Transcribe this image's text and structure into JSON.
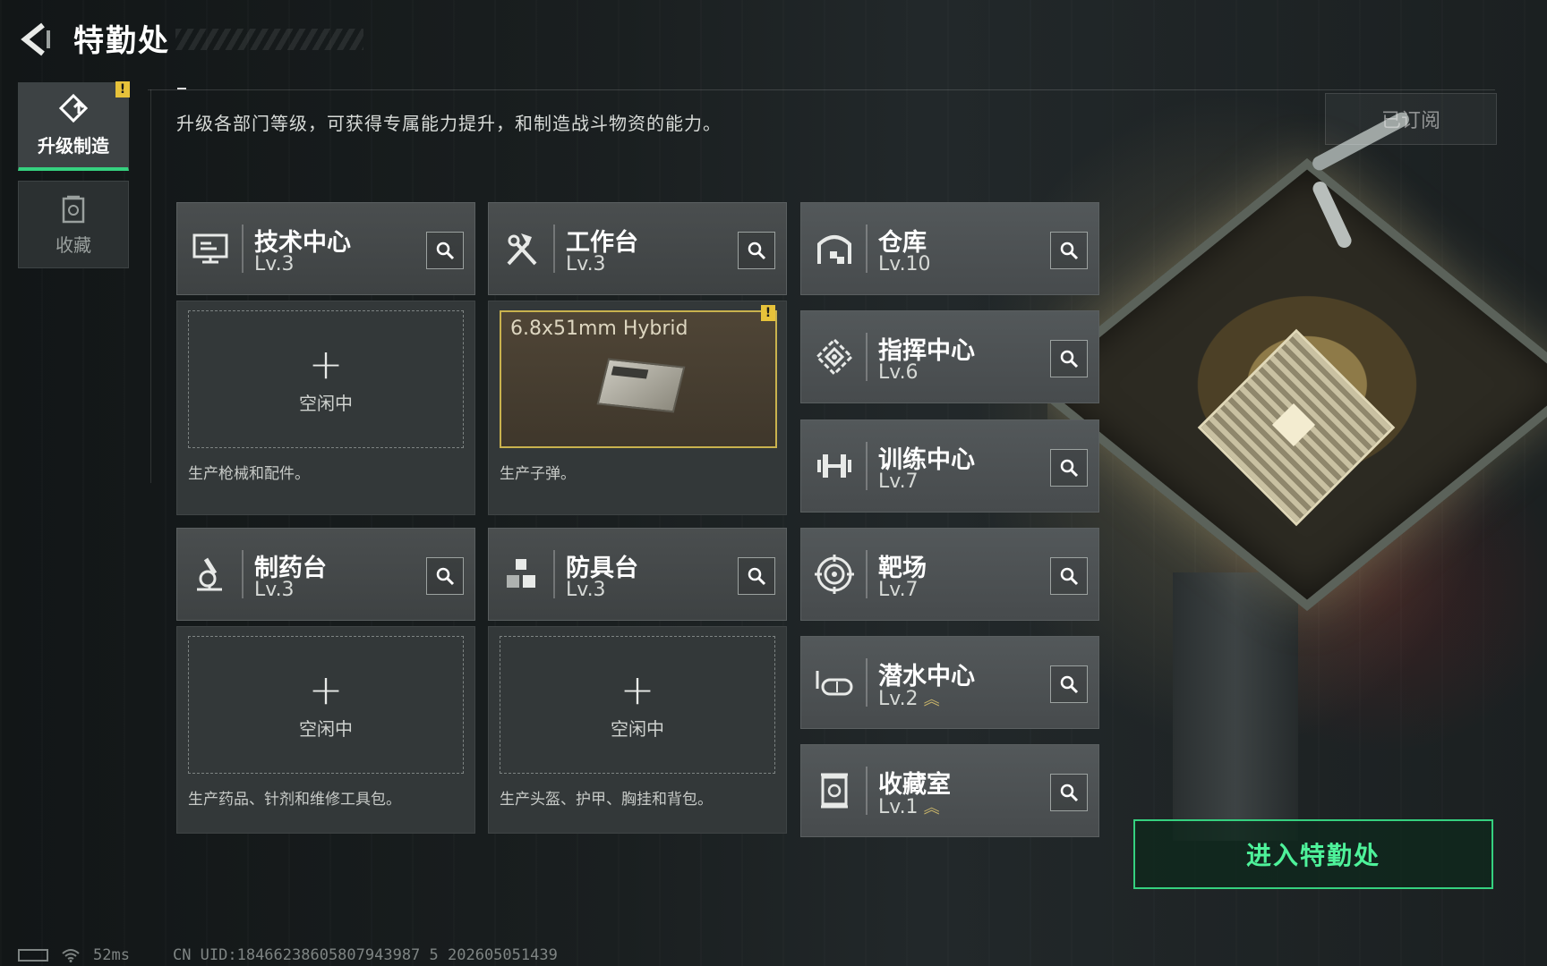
{
  "header": {
    "title": "特勤处",
    "description": "升级各部门等级，可获得专属能力提升，和制造战斗物资的能力。",
    "subscribed_label": "已订阅"
  },
  "side_tabs": [
    {
      "label": "升级制造",
      "icon": "upgrade-icon",
      "active": true,
      "badge": "!"
    },
    {
      "label": "收藏",
      "icon": "collection-icon",
      "active": false
    }
  ],
  "facilities": [
    {
      "name": "技术中心",
      "level": "Lv.3",
      "icon": "monitor-icon"
    },
    {
      "name": "工作台",
      "level": "Lv.3",
      "icon": "hammer-wrench-icon"
    },
    {
      "name": "仓库",
      "level": "Lv.10",
      "icon": "warehouse-icon"
    },
    {
      "name": "指挥中心",
      "level": "Lv.6",
      "icon": "command-icon"
    },
    {
      "name": "训练中心",
      "level": "Lv.7",
      "icon": "dumbbell-icon"
    },
    {
      "name": "制药台",
      "level": "Lv.3",
      "icon": "microscope-icon"
    },
    {
      "name": "防具台",
      "level": "Lv.3",
      "icon": "blocks-icon"
    },
    {
      "name": "靶场",
      "level": "Lv.7",
      "icon": "target-icon"
    },
    {
      "name": "潜水中心",
      "level": "Lv.2",
      "icon": "diving-mask-icon",
      "upgradeable": true
    },
    {
      "name": "收藏室",
      "level": "Lv.1",
      "icon": "collection-room-icon",
      "upgradeable": true
    }
  ],
  "slots": [
    {
      "status": "空闲中",
      "plus": "+",
      "description": "生产枪械和配件。"
    },
    {
      "job": "6.8x51mm Hybrid",
      "badge": "!",
      "description": "生产子弹。"
    },
    {
      "status": "空闲中",
      "plus": "+",
      "description": "生产药品、针剂和维修工具包。"
    },
    {
      "status": "空闲中",
      "plus": "+",
      "description": "生产头盔、护甲、胸挂和背包。"
    }
  ],
  "enter_button": "进入特勤处",
  "status_bar": {
    "ping": "52ms",
    "uid": "CN UID:18466238605807943987 5  202605051439"
  },
  "colors": {
    "accent_green": "#35d17f",
    "warning_yellow": "#e7c23a",
    "job_border": "#c9b24e"
  }
}
